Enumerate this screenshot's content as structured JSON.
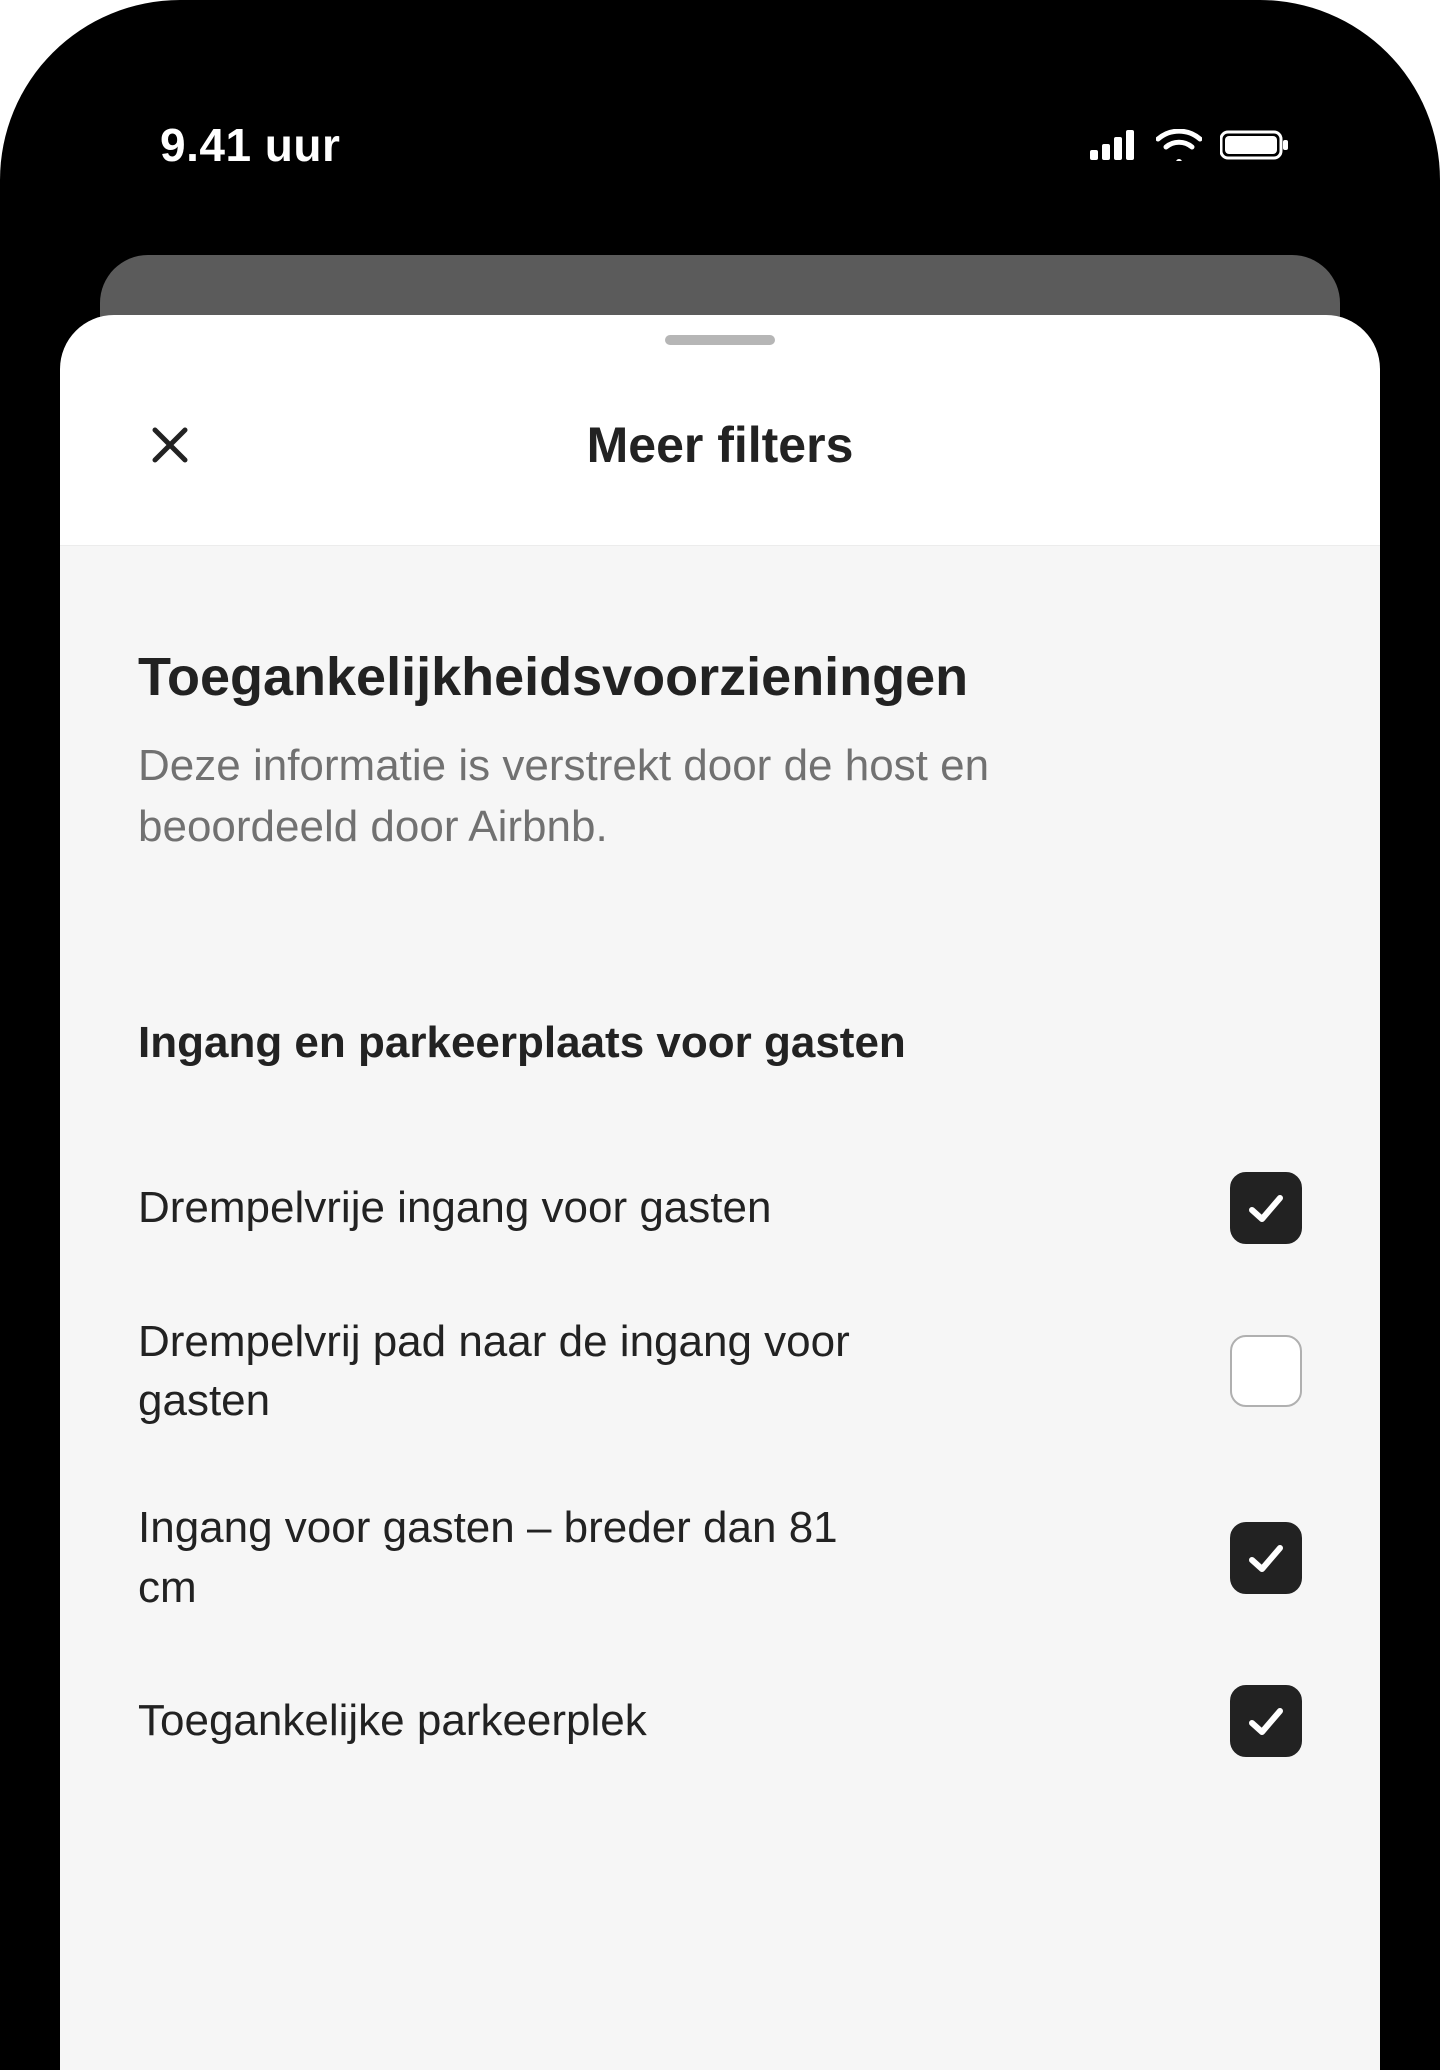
{
  "status": {
    "time": "9.41 uur"
  },
  "sheet": {
    "title": "Meer filters",
    "section": {
      "heading": "Toegankelijkheidsvoorzieningen",
      "subheading": "Deze informatie is verstrekt door de host en beoordeeld door Airbnb."
    },
    "group": {
      "title": "Ingang en parkeerplaats voor gasten",
      "options": [
        {
          "label": "Drempelvrije ingang voor gasten",
          "checked": true
        },
        {
          "label": "Drempelvrij pad naar de ingang voor gasten",
          "checked": false
        },
        {
          "label": "Ingang voor gasten – breder dan 81 cm",
          "checked": true
        },
        {
          "label": "Toegankelijke parkeerplek",
          "checked": true
        }
      ]
    }
  }
}
